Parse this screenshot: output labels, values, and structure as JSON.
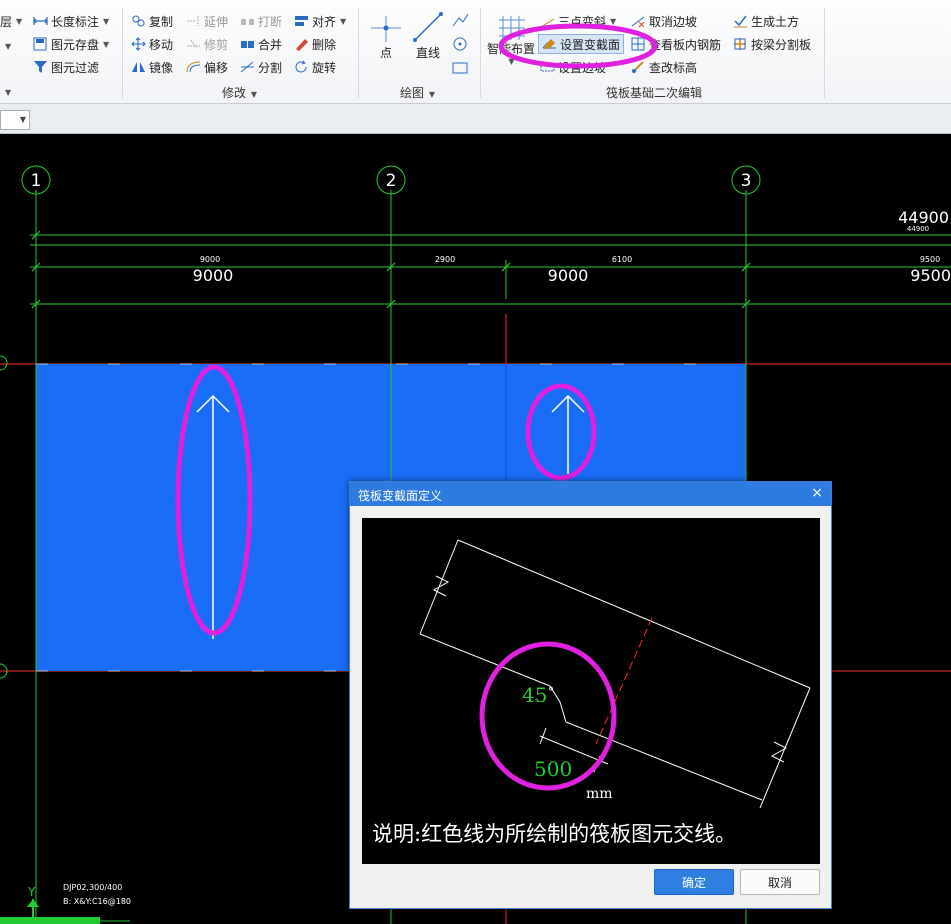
{
  "ribbon": {
    "g1": {
      "layer_label": "层",
      "dim_label": "长度标注",
      "save_label": "图元存盘",
      "filter_label": "图元过滤"
    },
    "modify": {
      "group_label": "修改",
      "copy": "复制",
      "extend": "延伸",
      "break": "打断",
      "align": "对齐",
      "move": "移动",
      "trim": "修剪",
      "merge": "合并",
      "delete": "删除",
      "mirror": "镜像",
      "offset": "偏移",
      "split": "分割",
      "rotate": "旋转"
    },
    "draw": {
      "group_label": "绘图",
      "point": "点",
      "line": "直线"
    },
    "raft": {
      "group_label": "筏板基础二次编辑",
      "smart_place": "智能布置",
      "three_point_slope": "三点变斜",
      "set_section": "设置变截面",
      "set_edge_slope": "设置边坡",
      "cancel_edge_slope": "取消边坡",
      "view_rebar": "查看板内钢筋",
      "check_elevation": "查改标高",
      "gen_earthwork": "生成土方",
      "split_by_beam": "按梁分割板"
    }
  },
  "canvas": {
    "axis_labels": [
      "1",
      "2",
      "3"
    ],
    "dim_total": "44900",
    "dim_total_small": "44900",
    "dims_small": [
      "9000",
      "2900",
      "6100",
      "9500"
    ],
    "dims_large": [
      "9000",
      "9000",
      "9500"
    ],
    "info_line1": "DJP02,300/400",
    "info_line2": "B: X&Y:C16@180",
    "ucs_label": "Y",
    "colors": {
      "slab": "#1a6df5",
      "grid": "#22cc33",
      "axis_red": "#ff2a2a",
      "highlight": "#e021e0"
    }
  },
  "dialog": {
    "title": "筏板变截面定义",
    "close": "×",
    "angle_value": "45",
    "angle_unit": "°",
    "width_value": "500",
    "unit": "mm",
    "note": "说明:红色线为所绘制的筏板图元交线。",
    "ok": "确定",
    "cancel": "取消"
  }
}
